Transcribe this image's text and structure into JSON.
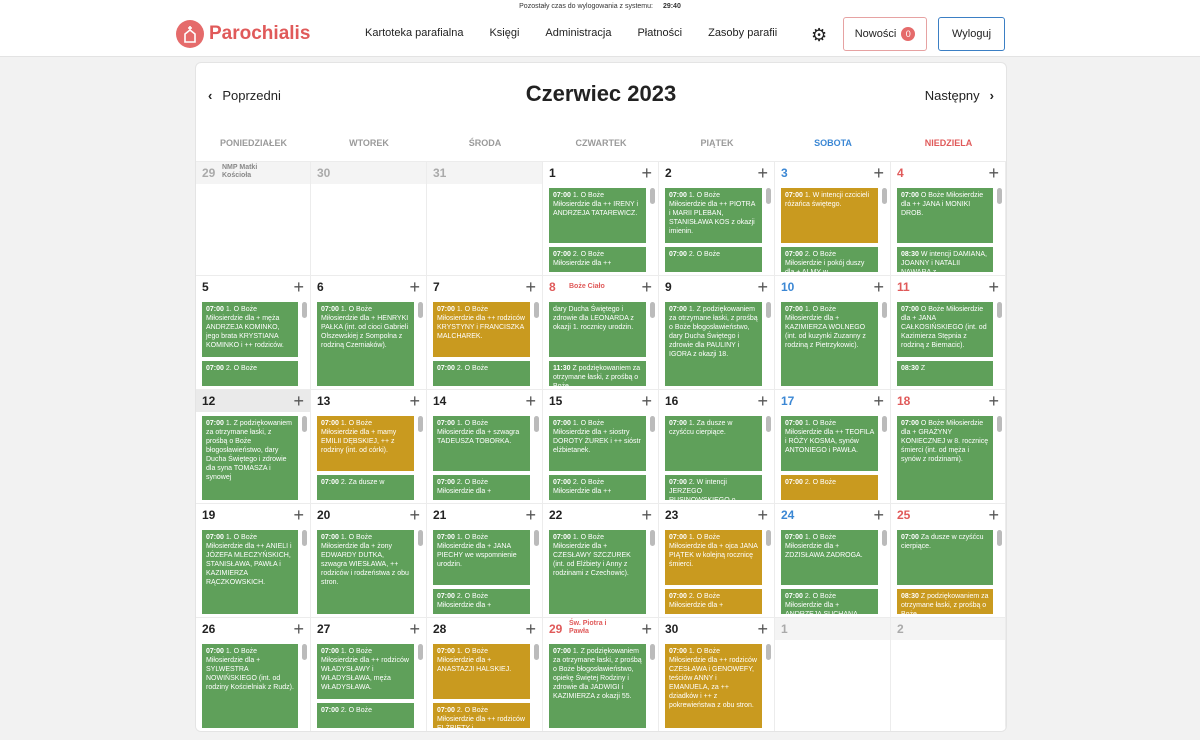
{
  "session": {
    "label": "Pozostały czas do wylogowania z systemu:",
    "time": "29:40"
  },
  "app": {
    "name": "Parochialis"
  },
  "nav": {
    "items": [
      "Kartoteka parafialna",
      "Księgi",
      "Administracja",
      "Płatności",
      "Zasoby parafii"
    ],
    "news_label": "Nowości",
    "news_count": "0",
    "logout_label": "Wyloguj"
  },
  "calendar": {
    "title": "Czerwiec 2023",
    "prev_label": "Poprzedni",
    "next_label": "Następny",
    "days_of_week": [
      "PONIEDZIAŁEK",
      "WTOREK",
      "ŚRODA",
      "CZWARTEK",
      "PIĄTEK",
      "SOBOTA",
      "NIEDZIELA"
    ],
    "colors": {
      "green": "#5fa05a",
      "gold": "#c99a1f",
      "saturday": "#3b87d4",
      "sunday": "#e05a5a"
    },
    "weeks": [
      [
        {
          "day": "29",
          "other": true,
          "feast": "NMP Matki Kościoła",
          "events": []
        },
        {
          "day": "30",
          "other": true,
          "events": []
        },
        {
          "day": "31",
          "other": true,
          "events": []
        },
        {
          "day": "1",
          "events": [
            {
              "time": "07:00",
              "text": "1. O Boże Miłosierdzie dla ++ IRENY i ANDRZEJA TATAREWICZ.",
              "color": "green"
            },
            {
              "time": "07:00",
              "text": "2. O Boże Miłosierdzie dla ++",
              "color": "green"
            }
          ]
        },
        {
          "day": "2",
          "events": [
            {
              "time": "07:00",
              "text": "1. O Boże Miłosierdzie dla ++ PIOTRA i MARII PLEBAN, STANISŁAWA KOS z okazji imienin.",
              "color": "green"
            },
            {
              "time": "07:00",
              "text": "2. O Boże",
              "color": "green"
            }
          ]
        },
        {
          "day": "3",
          "events": [
            {
              "time": "07:00",
              "text": "1. W intencji czcicieli różańca świętego.",
              "color": "gold"
            },
            {
              "time": "07:00",
              "text": "2. O Boże Miłosierdzie i pokój duszy dla + ALMY w",
              "color": "green"
            }
          ]
        },
        {
          "day": "4",
          "events": [
            {
              "time": "07:00",
              "text": "O Boże Miłosierdzie dla ++ JANA i MONIKI DROB.",
              "color": "green"
            },
            {
              "time": "08:30",
              "text": "W intencji DAMIANA, JOANNY i NATALII NAWARA z",
              "color": "green"
            }
          ]
        }
      ],
      [
        {
          "day": "5",
          "events": [
            {
              "time": "07:00",
              "text": "1. O Boże Miłosierdzie dla + męża ANDRZEJA KOMINKO, jego brata KRYSTIANA KOMINKO i ++ rodziców.",
              "color": "green"
            },
            {
              "time": "07:00",
              "text": "2. O Boże",
              "color": "green"
            }
          ]
        },
        {
          "day": "6",
          "events": [
            {
              "time": "07:00",
              "text": "1. O Boże Miłosierdzie dla + HENRYKI PAŁKA (int. od cioci Gabrieli Olszewskiej z Sompolna z rodziną Czerniaków).",
              "color": "green"
            }
          ]
        },
        {
          "day": "7",
          "events": [
            {
              "time": "07:00",
              "text": "1. O Boże Miłosierdzie dla ++ rodziców KRYSTYNY i FRANCISZKA MALCHAREK.",
              "color": "gold"
            },
            {
              "time": "07:00",
              "text": "2. O Boże",
              "color": "green"
            }
          ]
        },
        {
          "day": "8",
          "feast": "Boże Ciało",
          "events": [
            {
              "time": "",
              "text": "dary Ducha Świętego i zdrowie dla LEONARDA z okazji 1. rocznicy urodzin.",
              "color": "green"
            },
            {
              "time": "11:30",
              "text": "Z podziękowaniem za otrzymane łaski, z prośbą o Boże",
              "color": "green"
            }
          ]
        },
        {
          "day": "9",
          "events": [
            {
              "time": "07:00",
              "text": "1. Z podziękowaniem za otrzymane łaski, z prośbą o Boże błogosławieństwo, dary Ducha Świętego i zdrowie dla PAULINY i IGORA z okazji 18.",
              "color": "green"
            }
          ]
        },
        {
          "day": "10",
          "events": [
            {
              "time": "07:00",
              "text": "1. O Boże Miłosierdzie dla + KAZIMIERZA WOLNEGO (int. od kuzynki Zuzanny z rodziną z Pietrzykowic).",
              "color": "green"
            }
          ]
        },
        {
          "day": "11",
          "events": [
            {
              "time": "07:00",
              "text": "O Boże Miłosierdzie dla + JANA CAŁKOSIŃSKIEGO (int. od Kazimierza Stępnia z rodziną z Biernacic).",
              "color": "green"
            },
            {
              "time": "08:30",
              "text": "Z",
              "color": "green"
            }
          ]
        }
      ],
      [
        {
          "day": "12",
          "today": true,
          "events": [
            {
              "time": "07:00",
              "text": "1. Z podziękowaniem za otrzymane łaski, z prośbą o Boże błogosławieństwo, dary Ducha Świętego i zdrowie dla syna TOMASZA i synowej",
              "color": "green"
            }
          ]
        },
        {
          "day": "13",
          "events": [
            {
              "time": "07:00",
              "text": "1. O Boże Miłosierdzie dla + mamy EMILII DĘBSKIEJ, ++ z rodziny (int. od córki).",
              "color": "gold"
            },
            {
              "time": "07:00",
              "text": "2. Za dusze w",
              "color": "green"
            }
          ]
        },
        {
          "day": "14",
          "events": [
            {
              "time": "07:00",
              "text": "1. O Boże Miłosierdzie dla + szwagra TADEUSZA TOBORKA.",
              "color": "green"
            },
            {
              "time": "07:00",
              "text": "2. O Boże Miłosierdzie dla +",
              "color": "green"
            }
          ]
        },
        {
          "day": "15",
          "events": [
            {
              "time": "07:00",
              "text": "1. O Boże Miłosierdzie dla + siostry DOROTY ŻUREK i ++ sióstr elżbietanek.",
              "color": "green"
            },
            {
              "time": "07:00",
              "text": "2. O Boże Miłosierdzie dla ++",
              "color": "green"
            }
          ]
        },
        {
          "day": "16",
          "events": [
            {
              "time": "07:00",
              "text": "1. Za dusze w czyśćcu cierpiące.",
              "color": "green"
            },
            {
              "time": "07:00",
              "text": "2. W intencji JERZEGO RUSINOWSKIEGO o potrzebne łaski dla",
              "color": "green"
            }
          ]
        },
        {
          "day": "17",
          "events": [
            {
              "time": "07:00",
              "text": "1. O Boże Miłosierdzie dla ++ TEOFILA i RÓŻY KOSMA, synów ANTONIEGO i PAWŁA.",
              "color": "green"
            },
            {
              "time": "07:00",
              "text": "2. O Boże",
              "color": "gold"
            }
          ]
        },
        {
          "day": "18",
          "events": [
            {
              "time": "07:00",
              "text": "O Boże Miłosierdzie dla + GRAŻYNY KONIECZNEJ w 8. rocznicę śmierci (int. od męża i synów z rodzinami).",
              "color": "green"
            }
          ]
        }
      ],
      [
        {
          "day": "19",
          "events": [
            {
              "time": "07:00",
              "text": "1. O Boże Miłosierdzie dla ++ ANIELI i JÓZEFA MLECZYŃSKICH, STANISŁAWA, PAWŁA i KAZIMIERZA RĄCZKOWSKICH.",
              "color": "green"
            }
          ]
        },
        {
          "day": "20",
          "events": [
            {
              "time": "07:00",
              "text": "1. O Boże Miłosierdzie dla + żony EDWARDY DUTKA, szwagra WIESŁAWA, ++ rodziców i rodzeństwa z obu stron.",
              "color": "green"
            }
          ]
        },
        {
          "day": "21",
          "events": [
            {
              "time": "07:00",
              "text": "1. O Boże Miłosierdzie dla + JANA PIECHY we wspomnienie urodzin.",
              "color": "green"
            },
            {
              "time": "07:00",
              "text": "2. O Boże Miłosierdzie dla +",
              "color": "green"
            }
          ]
        },
        {
          "day": "22",
          "events": [
            {
              "time": "07:00",
              "text": "1. O Boże Miłosierdzie dla + CZESŁAWY SZCZUREK (int. od Elżbiety i Anny z rodzinami z Czechowic).",
              "color": "green"
            }
          ]
        },
        {
          "day": "23",
          "events": [
            {
              "time": "07:00",
              "text": "1. O Boże Miłosierdzie dla + ojca JANA PIĄTEK w kolejną rocznicę śmierci.",
              "color": "gold"
            },
            {
              "time": "07:00",
              "text": "2. O Boże Miłosierdzie dla +",
              "color": "gold"
            }
          ]
        },
        {
          "day": "24",
          "events": [
            {
              "time": "07:00",
              "text": "1. O Boże Miłosierdzie dla + ZDZISŁAWA ZADROGA.",
              "color": "green"
            },
            {
              "time": "07:00",
              "text": "2. O Boże Miłosierdzie dla + ANDRZEJA SUCHANA",
              "color": "green"
            }
          ]
        },
        {
          "day": "25",
          "events": [
            {
              "time": "07:00",
              "text": "Za dusze w czyśćcu cierpiące.",
              "color": "green"
            },
            {
              "time": "08:30",
              "text": "Z podziękowaniem za otrzymane łaski, z prośbą o Boże",
              "color": "gold"
            }
          ]
        }
      ],
      [
        {
          "day": "26",
          "events": [
            {
              "time": "07:00",
              "text": "1. O Boże Miłosierdzie dla + SYLWESTRA NOWIŃSKIEGO (int. od rodziny Kościelniak z Rudz).",
              "color": "green"
            }
          ]
        },
        {
          "day": "27",
          "events": [
            {
              "time": "07:00",
              "text": "1. O Boże Miłosierdzie dla ++ rodziców WŁADYSŁAWY i WŁADYSŁAWA, męża WŁADYSŁAWA.",
              "color": "green"
            },
            {
              "time": "07:00",
              "text": "2. O Boże",
              "color": "green"
            }
          ]
        },
        {
          "day": "28",
          "events": [
            {
              "time": "07:00",
              "text": "1. O Boże Miłosierdzie dla + ANASTAZJI HALSKIEJ.",
              "color": "gold"
            },
            {
              "time": "07:00",
              "text": "2. O Boże Miłosierdzie dla ++ rodziców ELŻBIETY i",
              "color": "gold"
            }
          ]
        },
        {
          "day": "29",
          "feast": "Św. Piotra i Pawła",
          "events": [
            {
              "time": "07:00",
              "text": "1. Z podziękowaniem za otrzymane łaski, z prośbą o Boże błogosławieństwo, opiekę Świętej Rodziny i zdrowie dla JADWIGI i KAZIMIERZA z okazji 55.",
              "color": "green"
            }
          ]
        },
        {
          "day": "30",
          "events": [
            {
              "time": "07:00",
              "text": "1. O Boże Miłosierdzie dla ++ rodziców CZESŁAWA i GENOWEFY, teściów ANNY i EMANUELA, za ++ dziadków i ++ z pokrewieństwa z obu stron.",
              "color": "gold"
            }
          ]
        },
        {
          "day": "1",
          "other": true,
          "events": []
        },
        {
          "day": "2",
          "other": true,
          "events": []
        }
      ]
    ]
  }
}
